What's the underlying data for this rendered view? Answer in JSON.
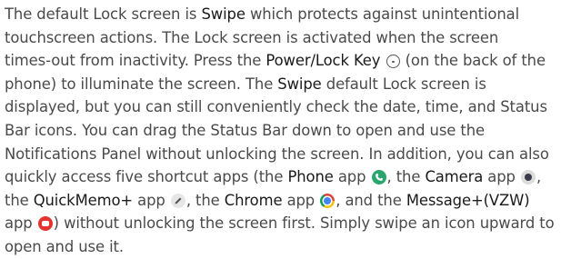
{
  "paragraph": {
    "l1a": "The default Lock screen is ",
    "swipe1": "Swipe",
    "l1b": " which protects against unintentional",
    "l2": "touchscreen actions. The Lock screen is activated when the screen",
    "l3a": "times-out from inactivity. Press the ",
    "power_key": "Power/Lock Key",
    "l3b": " (on the back of the",
    "l4a": "phone) to illuminate the screen. The ",
    "swipe2": "Swipe",
    "l4b": " default Lock screen is",
    "l5": "displayed, but you can still conveniently check the date, time, and Status",
    "l6": "Bar icons. You can drag the Status Bar down to open and use the",
    "l7": "Notifications Panel without unlocking the screen. In addition, you can also",
    "l8a": "quickly access five shortcut apps (the ",
    "phone_app": "Phone",
    "l8b": " app ",
    "l8c": ", the ",
    "camera_app": "Camera",
    "l8d": " app ",
    "l8e": ",",
    "l9a": "the ",
    "memo_app": "QuickMemo+",
    "l9b": " app ",
    "l9c": ", the ",
    "chrome_app": "Chrome",
    "l9d": " app ",
    "l9e": ", and the ",
    "message_app": "Message+(VZW)",
    "l10a": "app ",
    "l10b": ") without unlocking the screen first. Simply swipe an icon upward to",
    "l11": "open and use it."
  },
  "icons": {
    "power": "power-lock-key-icon",
    "phone": "phone-app-icon",
    "camera": "camera-app-icon",
    "memo": "quickmemo-app-icon",
    "chrome": "chrome-app-icon",
    "message": "message-plus-app-icon"
  },
  "colors": {
    "text": "#4a4a4a",
    "emphasis": "#1a1a1a",
    "phone_green": "#2aa56d",
    "message_red": "#e3342f"
  }
}
